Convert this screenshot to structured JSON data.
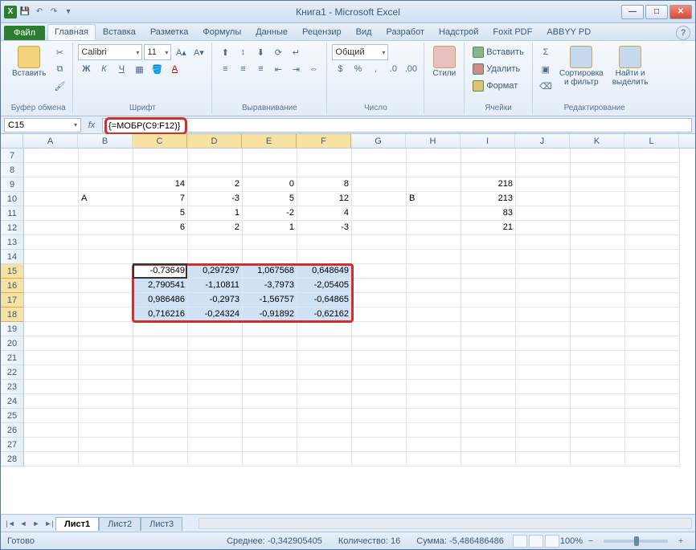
{
  "title": "Книга1 - Microsoft Excel",
  "tabs": {
    "file": "Файл",
    "items": [
      "Главная",
      "Вставка",
      "Разметка",
      "Формулы",
      "Данные",
      "Рецензир",
      "Вид",
      "Разработ",
      "Надстрой",
      "Foxit PDF",
      "ABBYY PD"
    ],
    "active": 0
  },
  "ribbon": {
    "clipboard": {
      "label": "Буфер обмена",
      "paste": "Вставить"
    },
    "font": {
      "label": "Шрифт",
      "name": "Calibri",
      "size": "11"
    },
    "align": {
      "label": "Выравнивание"
    },
    "number": {
      "label": "Число",
      "format": "Общий"
    },
    "styles": {
      "label": "Стили"
    },
    "cells": {
      "label": "Ячейки",
      "insert": "Вставить",
      "delete": "Удалить",
      "format": "Формат"
    },
    "editing": {
      "label": "Редактирование",
      "sort": "Сортировка\nи фильтр",
      "find": "Найти и\nвыделить"
    }
  },
  "namebox": "C15",
  "formula": "{=МОБР(C9:F12)}",
  "columns": [
    "A",
    "B",
    "C",
    "D",
    "E",
    "F",
    "G",
    "H",
    "I",
    "J",
    "K",
    "L"
  ],
  "rows": [
    "7",
    "8",
    "9",
    "10",
    "11",
    "12",
    "13",
    "14",
    "15",
    "16",
    "17",
    "18",
    "19",
    "20",
    "21",
    "22",
    "23",
    "24",
    "25",
    "26",
    "27",
    "28"
  ],
  "sel_cols": [
    "C",
    "D",
    "E",
    "F"
  ],
  "sel_rows": [
    "15",
    "16",
    "17",
    "18"
  ],
  "data": {
    "9": {
      "C": "14",
      "D": "2",
      "E": "0",
      "F": "8",
      "I": "218"
    },
    "10": {
      "B": "A",
      "C": "7",
      "D": "-3",
      "E": "5",
      "F": "12",
      "H": "B",
      "I": "213"
    },
    "11": {
      "C": "5",
      "D": "1",
      "E": "-2",
      "F": "4",
      "I": "83"
    },
    "12": {
      "C": "6",
      "D": "2",
      "E": "1",
      "F": "-3",
      "I": "21"
    },
    "15": {
      "C": "-0,73649",
      "D": "0,297297",
      "E": "1,067568",
      "F": "0,648649"
    },
    "16": {
      "C": "2,790541",
      "D": "-1,10811",
      "E": "-3,7973",
      "F": "-2,05405"
    },
    "17": {
      "C": "0,986486",
      "D": "-0,2973",
      "E": "-1,56757",
      "F": "-0,64865"
    },
    "18": {
      "C": "0,716216",
      "D": "-0,24324",
      "E": "-0,91892",
      "F": "-0,62162"
    }
  },
  "text_cells": {
    "10": [
      "B",
      "H"
    ]
  },
  "sheets": {
    "items": [
      "Лист1",
      "Лист2",
      "Лист3"
    ],
    "active": 0
  },
  "status": {
    "ready": "Готово",
    "avg_label": "Среднее:",
    "avg": "-0,342905405",
    "count_label": "Количество:",
    "count": "16",
    "sum_label": "Сумма:",
    "sum": "-5,486486486",
    "zoom": "100%"
  },
  "icons": {
    "sigma": "Σ",
    "min": "—",
    "max": "□",
    "close": "✕",
    "help": "?",
    "fx": "fx",
    "dd": "▾",
    "tri_l": "◄",
    "tri_r": "►",
    "plus": "+",
    "minus": "−"
  }
}
